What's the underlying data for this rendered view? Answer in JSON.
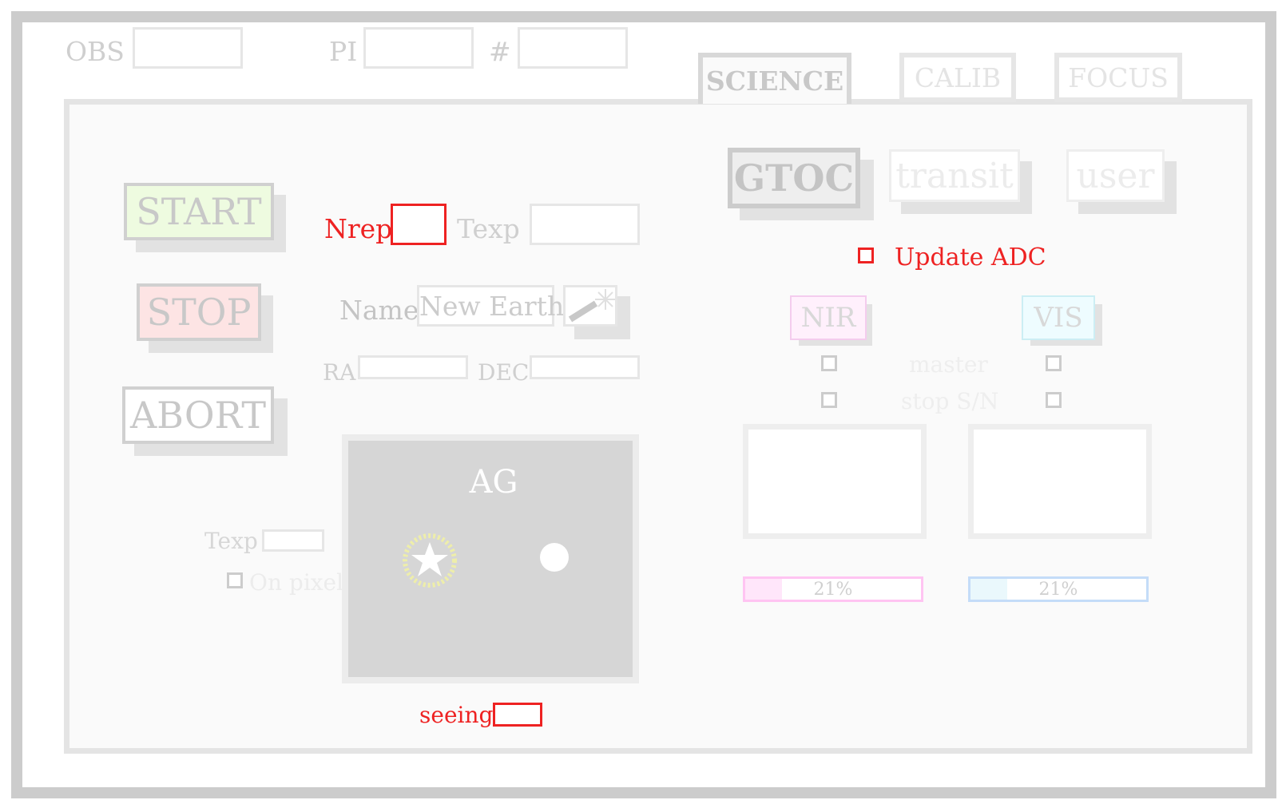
{
  "header": {
    "obs_label": "OBS",
    "pi_label": "PI",
    "num_label": "#"
  },
  "tabs": [
    {
      "label": "SCIENCE",
      "active": true
    },
    {
      "label": "CALIB",
      "active": false
    },
    {
      "label": "FOCUS",
      "active": false
    }
  ],
  "controls": {
    "start": "START",
    "stop": "STOP",
    "abort": "ABORT"
  },
  "exposure": {
    "nrep_label": "Nrep",
    "texp_label": "Texp",
    "name_label": "Name",
    "name_value": "New Earth",
    "ra_label": "RA",
    "dec_label": "DEC"
  },
  "modes": {
    "gtoc": "GTOC",
    "transit": "transit",
    "user": "user"
  },
  "adc": {
    "label": "Update ADC"
  },
  "arms": {
    "nir": "NIR",
    "vis": "VIS",
    "master_label": "master",
    "stop_sn_label": "stop S/N",
    "nir_progress": 21,
    "vis_progress": 21,
    "nir_progress_text": "21%",
    "vis_progress_text": "21%"
  },
  "ag": {
    "title": "AG",
    "texp_label": "Texp",
    "on_pixel_label": "On pixel",
    "seeing_label": "seeing"
  },
  "colors": {
    "accent_red": "#ee2222",
    "start_bg": "#eefbe0",
    "stop_bg": "#fde4e4",
    "nir_color": "#ffccf2",
    "vis_color": "#cce6ff"
  }
}
